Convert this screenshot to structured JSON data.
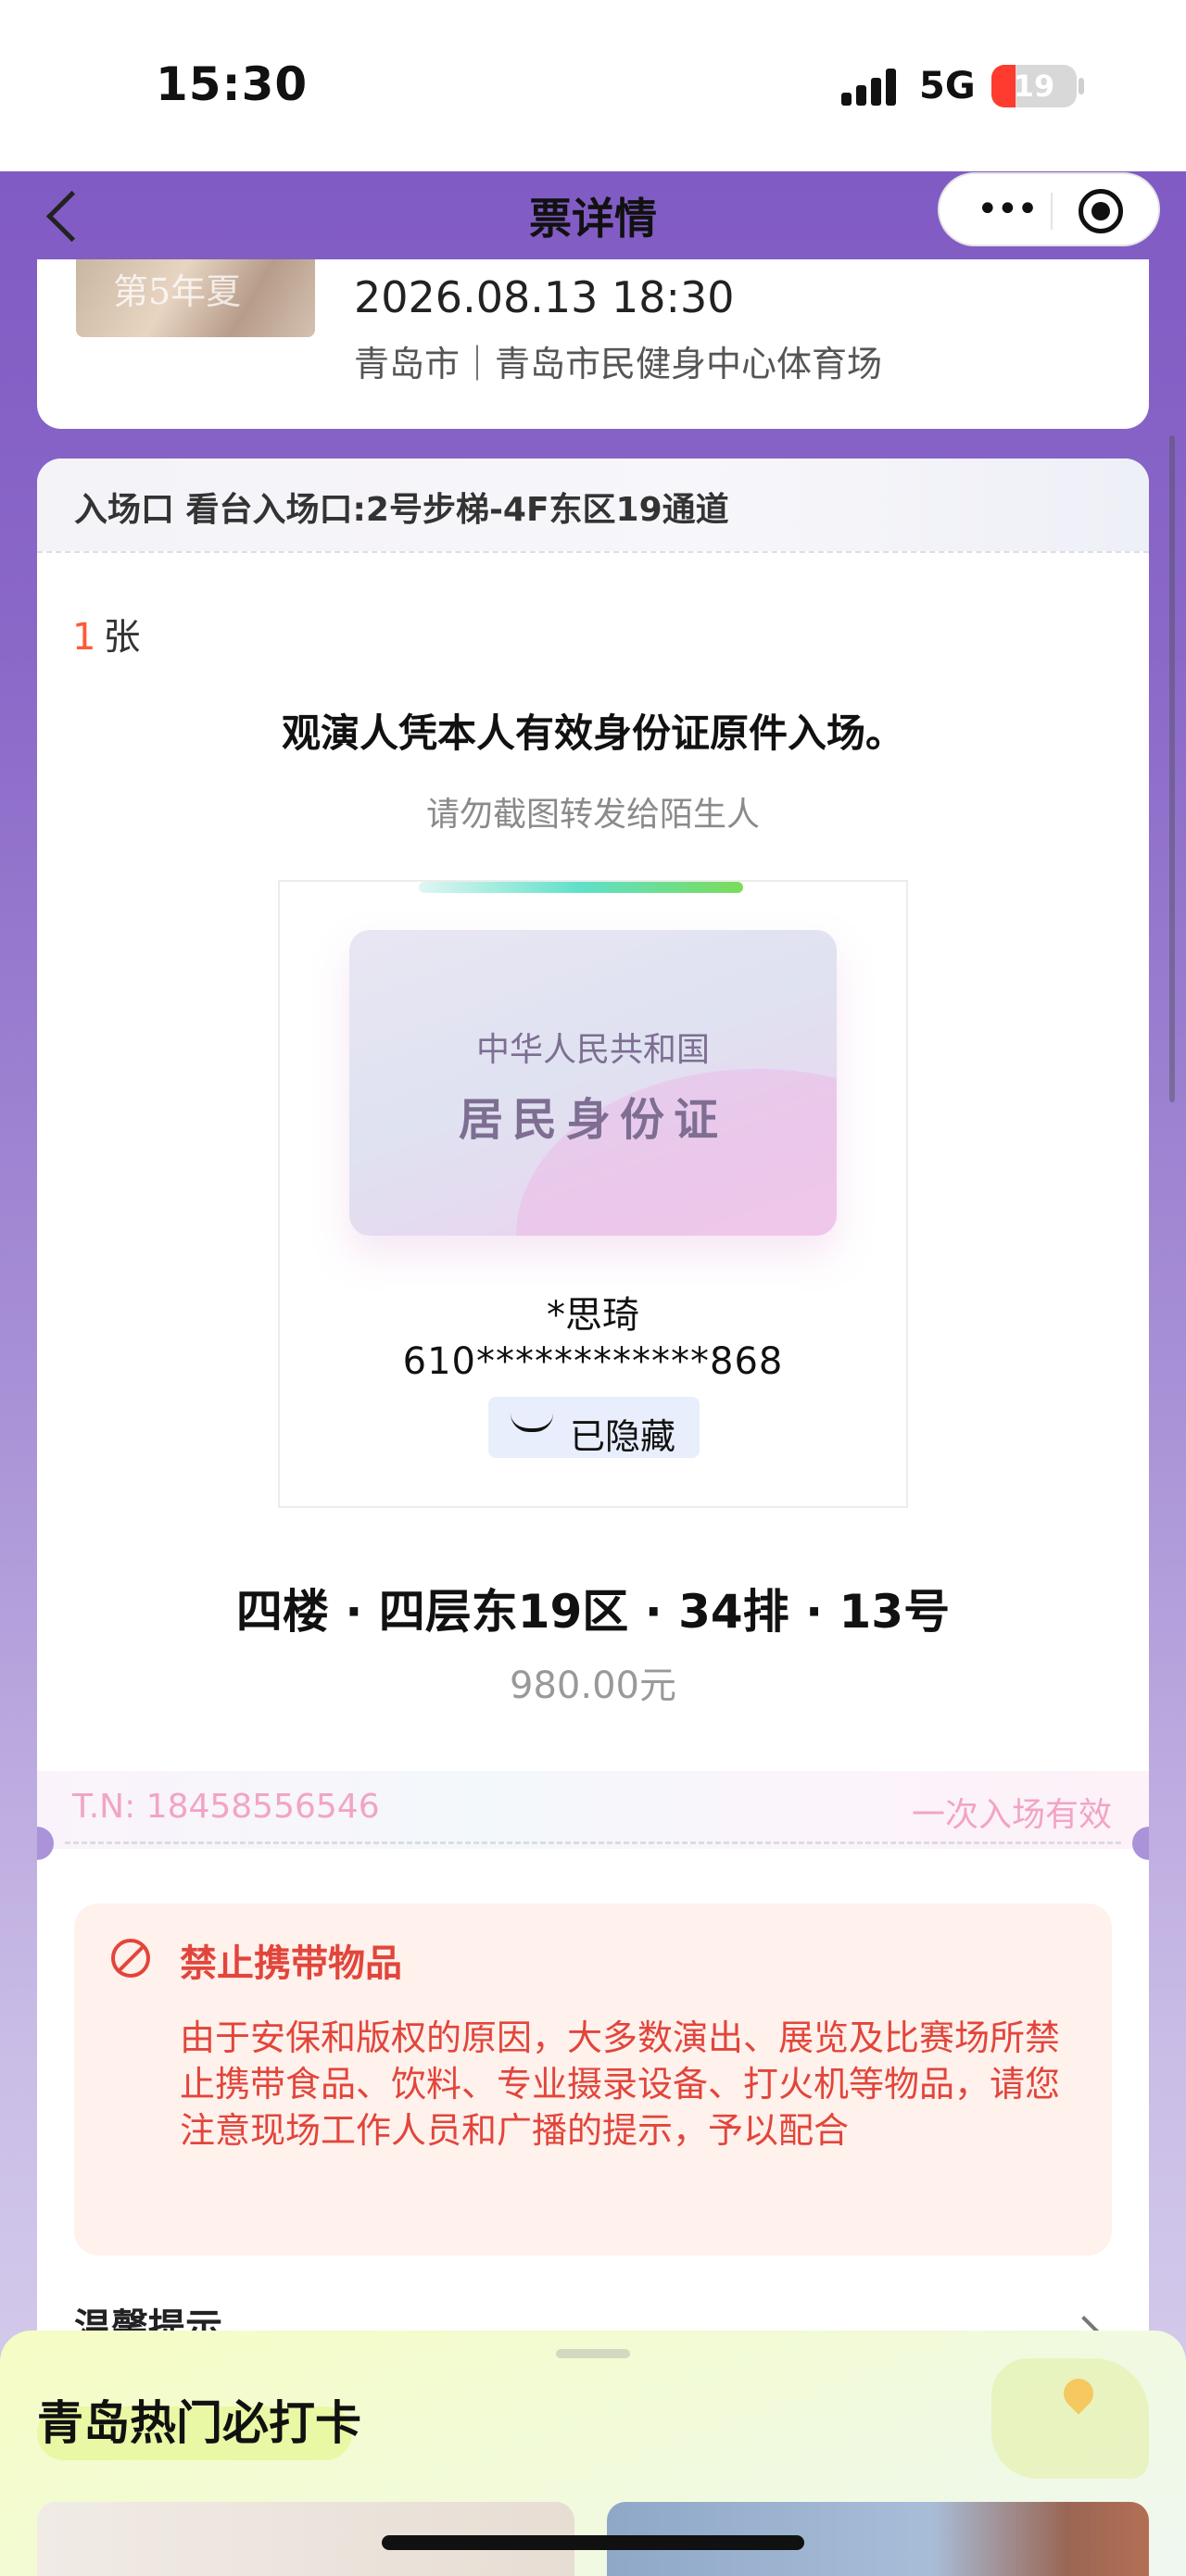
{
  "status_bar": {
    "time": "15:30",
    "network": "5G",
    "battery": "19"
  },
  "nav": {
    "title": "票详情"
  },
  "event": {
    "poster_text": "第5年夏",
    "datetime": "2026.08.13 18:30",
    "location": "青岛市｜青岛市民健身中心体育场"
  },
  "ticket": {
    "gate": "入场口 看台入场口:2号步梯-4F东区19通道",
    "count_num": "1",
    "count_unit": "张",
    "notice_main": "观演人凭本人有效身份证原件入场。",
    "notice_sub": "请勿截图转发给陌生人",
    "id_card": {
      "line1": "中华人民共和国",
      "line2": "居民身份证",
      "holder_name": "*思琦",
      "holder_id": "610************868",
      "hidden_label": "已隐藏"
    },
    "seat": "四楼 · 四层东19区 · 34排 · 13号",
    "price": "980.00元",
    "tn": "T.N:  18458556546",
    "validity": "一次入场有效"
  },
  "warning": {
    "title": "禁止携带物品",
    "body": "由于安保和版权的原因，大多数演出、展览及比赛场所禁止携带食品、饮料、专业摄录设备、打火机等物品，请您注意现场工作人员和广播的提示，予以配合"
  },
  "tips": {
    "title": "温馨提示"
  },
  "bottom_sheet": {
    "title": "青岛热门必打卡"
  },
  "colors": {
    "accent_red": "#e2453b",
    "count_orange": "#ff5a36",
    "tn_pink": "#f2a4c6",
    "bg_purple": "#7d56c2"
  }
}
